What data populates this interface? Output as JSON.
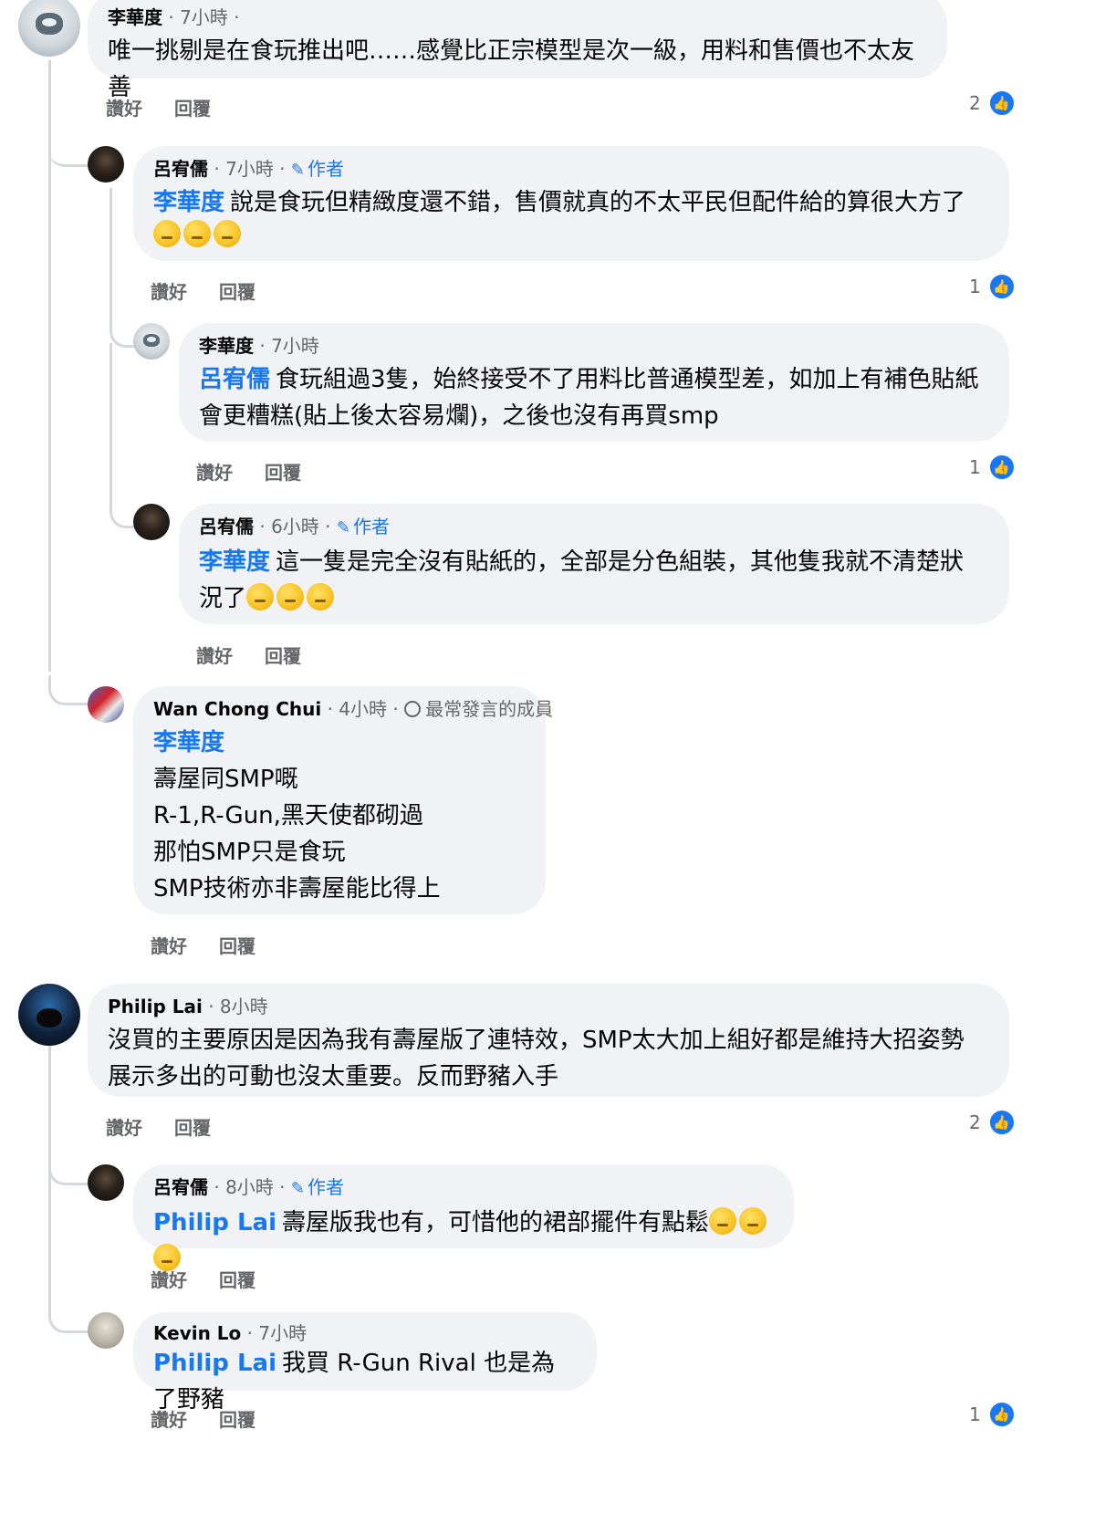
{
  "actions": {
    "like": "讚好",
    "reply": "回覆"
  },
  "threads": [
    {
      "comment": {
        "author": "李華度",
        "time": "· 7小時 ·",
        "text": "唯一挑剔是在食玩推出吧……感覺比正宗模型是次一級，用料和售價也不太友善",
        "likes": "2"
      },
      "replies": [
        {
          "author": "呂宥儒",
          "time": "· 7小時 ·",
          "badge": "作者",
          "mention": "李華度",
          "text": "說是食玩但精緻度還不錯，售價就真的不太平民但配件給的算很大方了",
          "likes": "1"
        },
        {
          "author": "李華度",
          "time": "· 7小時",
          "mention": "呂宥儒",
          "text_line1": "食玩組過3隻，始終接受不了用料比普通模型差，如加上有補色貼紙",
          "text_line2": "會更糟糕(貼上後太容易爛)，之後也沒有再買smp",
          "likes": "1"
        },
        {
          "author": "呂宥儒",
          "time": "· 6小時 ·",
          "badge": "作者",
          "mention": "李華度",
          "text_line1": "這一隻是完全沒有貼紙的，全部是分色組裝，其他隻我就不清楚狀",
          "text_line2": "況了"
        },
        {
          "author": "Wan Chong Chui",
          "time": "· 4小時 ·",
          "badge": "最常發言的成員",
          "mention": "李華度",
          "lines": [
            "壽屋同SMP嘅",
            "R-1,R-Gun,黑天使都砌過",
            "那怕SMP只是食玩",
            "SMP技術亦非壽屋能比得上"
          ]
        }
      ]
    },
    {
      "comment": {
        "author": "Philip Lai",
        "time": "· 8小時",
        "text_line1": "沒買的主要原因是因為我有壽屋版了連特效，SMP太大加上組好都是維持大招姿勢",
        "text_line2": "展示多出的可動也沒太重要。反而野豬入手",
        "likes": "2"
      },
      "replies": [
        {
          "author": "呂宥儒",
          "time": "· 8小時 ·",
          "badge": "作者",
          "mention": "Philip Lai",
          "text": "壽屋版我也有，可惜他的裙部擺件有點鬆"
        },
        {
          "author": "Kevin Lo",
          "time": "· 7小時",
          "mention": "Philip Lai",
          "text": "我買 R-Gun Rival 也是為了野豬",
          "likes": "1"
        }
      ]
    }
  ]
}
